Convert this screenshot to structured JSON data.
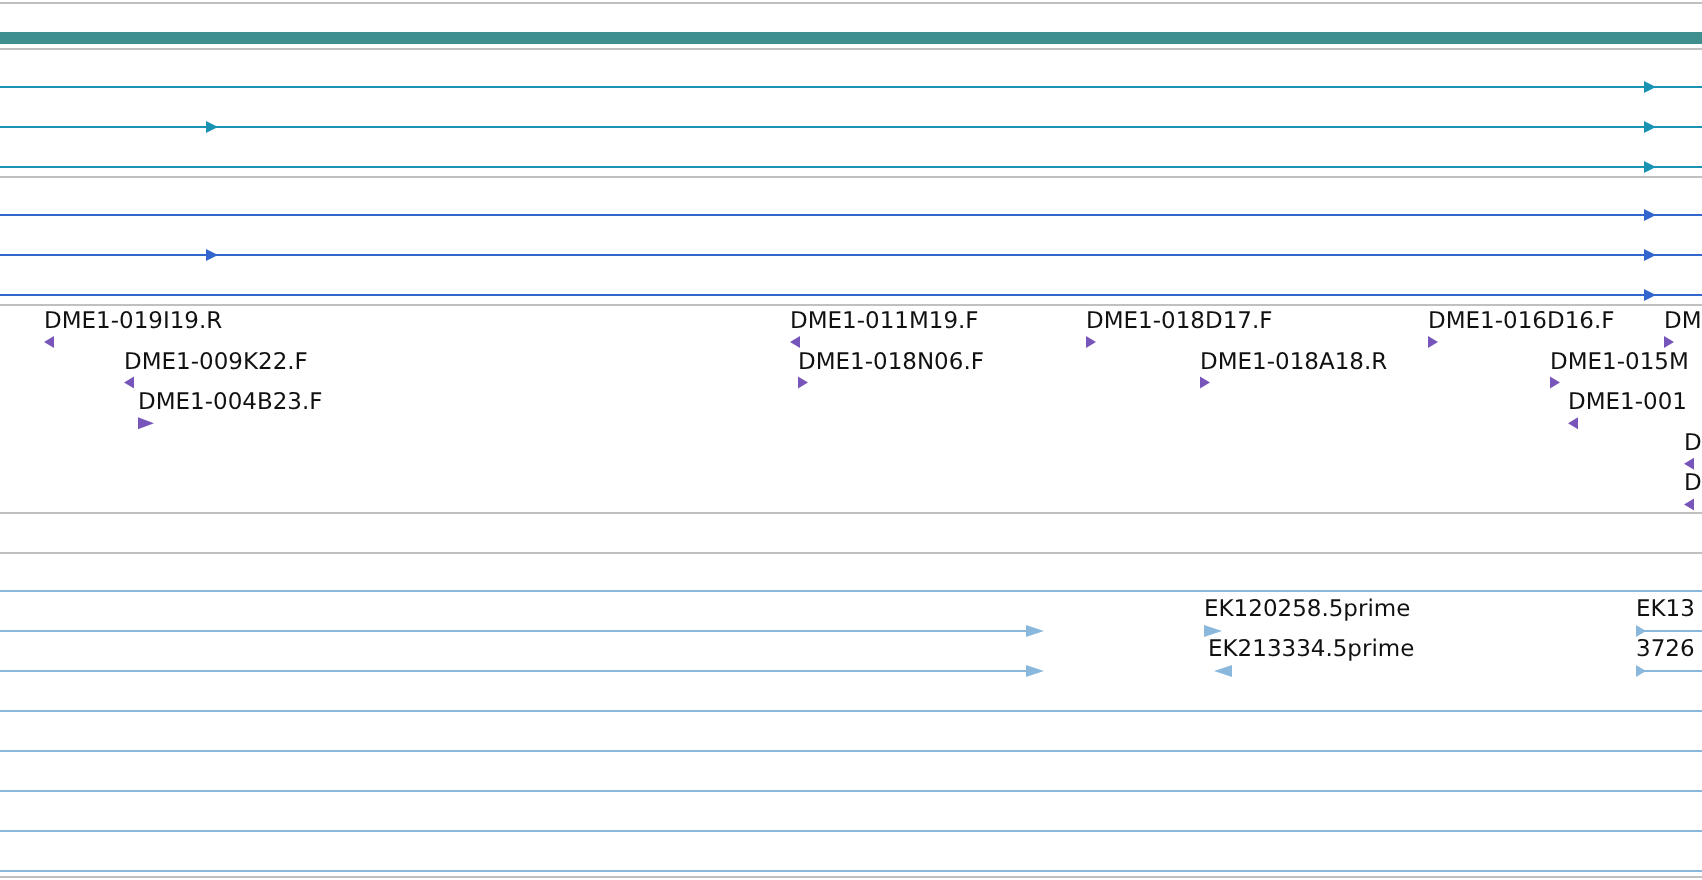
{
  "clone_features": [
    {
      "label": "DME1-019I19.R",
      "forward": false
    },
    {
      "label": "DME1-009K22.F",
      "forward": false
    },
    {
      "label": "DME1-004B23.F",
      "forward": true
    },
    {
      "label": "DME1-011M19.F",
      "forward": false
    },
    {
      "label": "DME1-018N06.F",
      "forward": true
    },
    {
      "label": "DME1-018D17.F",
      "forward": true
    },
    {
      "label": "DME1-018A18.R",
      "forward": true
    },
    {
      "label": "DME1-016D16.F",
      "forward": true
    },
    {
      "label": "DM",
      "forward": true
    },
    {
      "label": "DME1-015M",
      "forward": true
    },
    {
      "label": "DME1-001",
      "forward": false
    },
    {
      "label": "D",
      "forward": false
    },
    {
      "label": "D",
      "forward": false
    }
  ],
  "est_features": [
    {
      "label": "EK120258.5prime",
      "forward": true
    },
    {
      "label": "EK213334.5prime",
      "forward": false
    },
    {
      "label": "EK13",
      "forward": true
    },
    {
      "label": "3726",
      "forward": true
    }
  ]
}
